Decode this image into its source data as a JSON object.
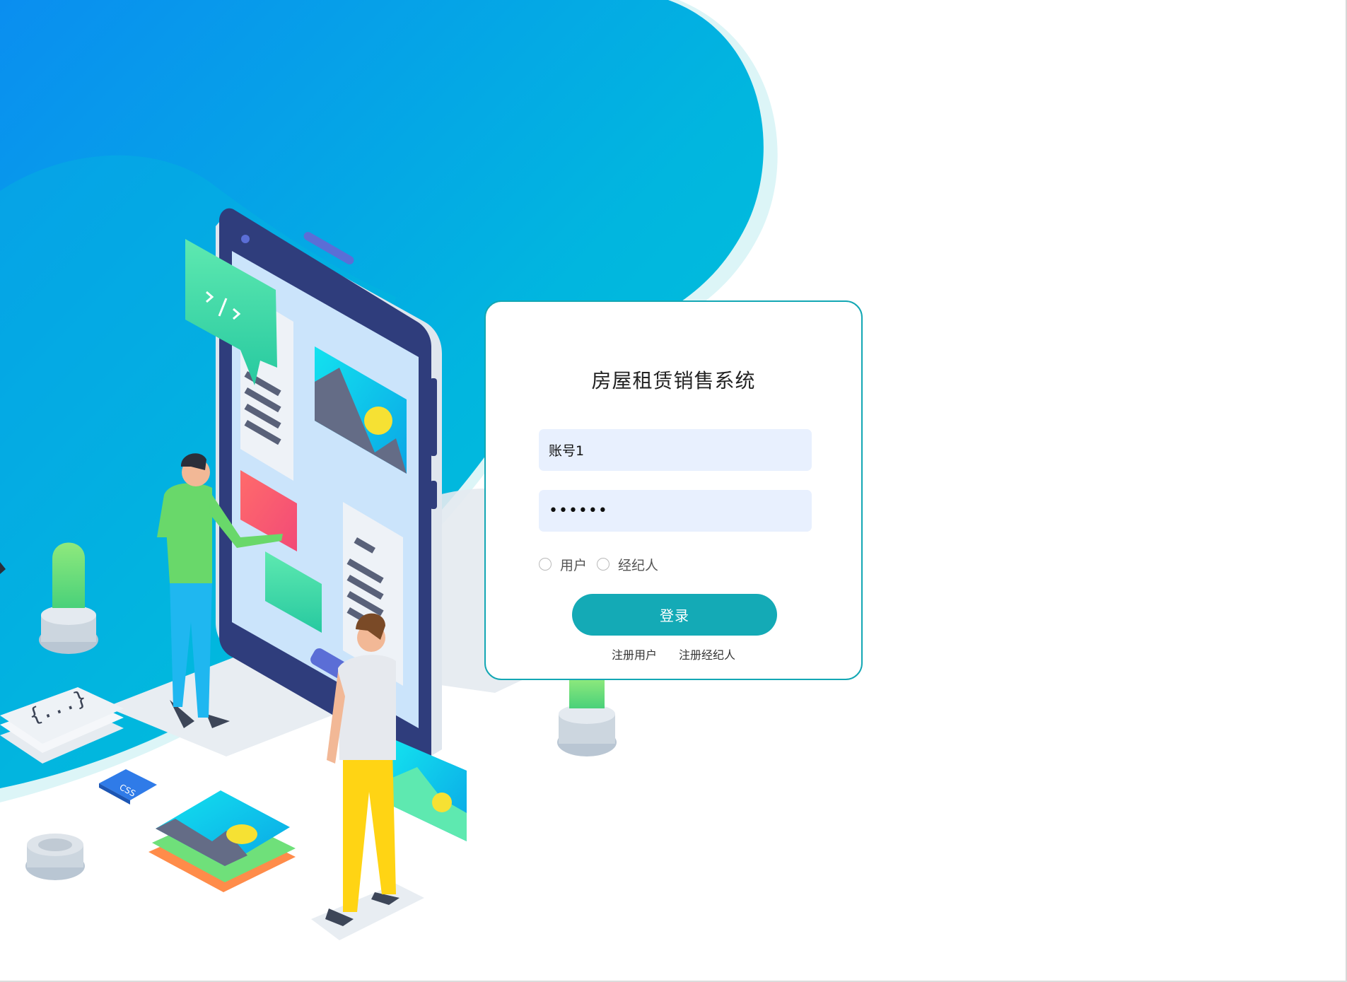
{
  "login": {
    "title": "房屋租赁销售系统",
    "account_value": "账号1",
    "password_value": "••••••",
    "roles": [
      {
        "label": "用户",
        "selected": false
      },
      {
        "label": "经纪人",
        "selected": false
      }
    ],
    "login_button": "登录",
    "register_user": "注册用户",
    "register_agent": "注册经纪人"
  },
  "colors": {
    "accent": "#14aab6",
    "input_bg": "#e8f0fe",
    "background_gradient": [
      "#0a8ef0",
      "#00c6d6"
    ]
  },
  "illustration": {
    "icons": [
      "code-icon",
      "image-icon",
      "css-badge"
    ]
  }
}
